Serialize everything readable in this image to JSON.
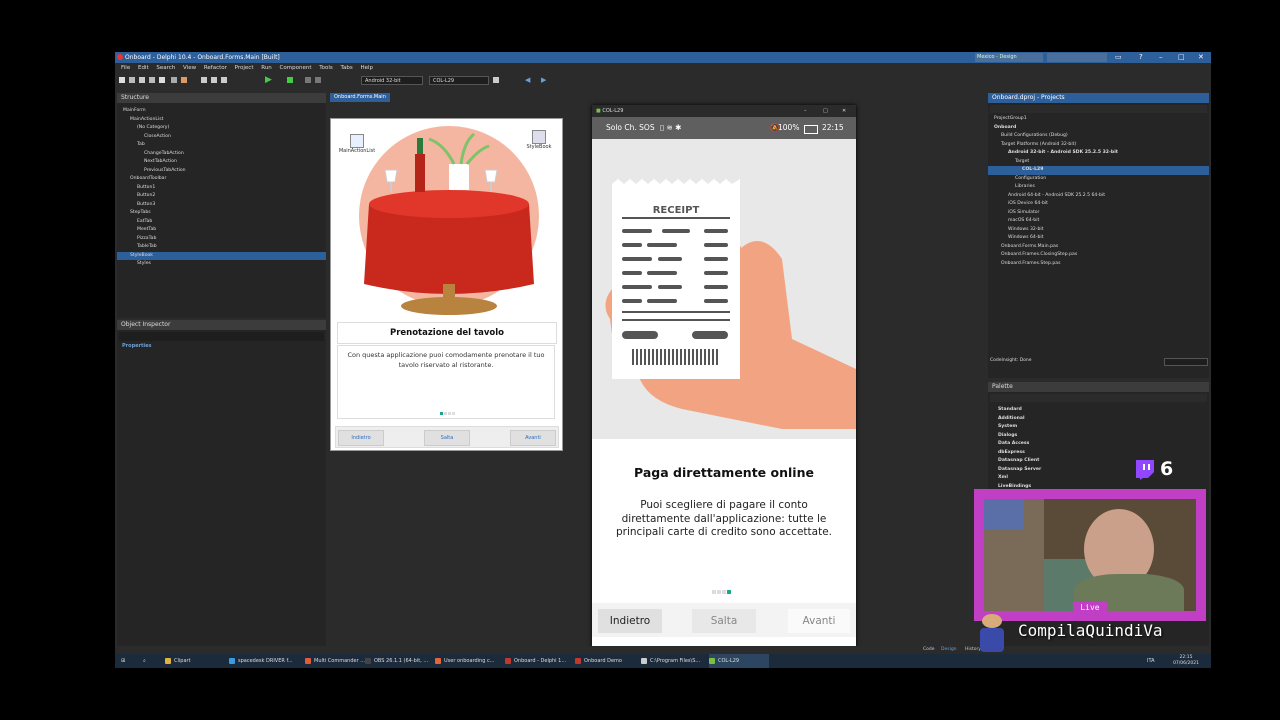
{
  "window": {
    "title": "Onboard - Delphi 10.4 - Onboard.Forms.Main [Built]",
    "search_placeholder": "Mexico - Design"
  },
  "menu": [
    "File",
    "Edit",
    "Search",
    "View",
    "Refactor",
    "Project",
    "Run",
    "Component",
    "Tools",
    "Tabs",
    "Help"
  ],
  "toolbar": {
    "platform": "Android 32-bit",
    "device": "COL-L29"
  },
  "structure": {
    "title": "Structure",
    "items": [
      {
        "label": "MainForm",
        "depth": 0
      },
      {
        "label": "MainActionList",
        "depth": 1
      },
      {
        "label": "(No Category)",
        "depth": 2
      },
      {
        "label": "CloseAction",
        "depth": 3
      },
      {
        "label": "Tab",
        "depth": 2
      },
      {
        "label": "ChangeTabAction",
        "depth": 3
      },
      {
        "label": "NextTabAction",
        "depth": 3
      },
      {
        "label": "PreviousTabAction",
        "depth": 3
      },
      {
        "label": "OnboardToolbar",
        "depth": 1
      },
      {
        "label": "Button1",
        "depth": 2
      },
      {
        "label": "Button2",
        "depth": 2
      },
      {
        "label": "Button3",
        "depth": 2
      },
      {
        "label": "StepTabs",
        "depth": 1
      },
      {
        "label": "EatTab",
        "depth": 2
      },
      {
        "label": "MeetTab",
        "depth": 2
      },
      {
        "label": "PizzaTab",
        "depth": 2
      },
      {
        "label": "TableTab",
        "depth": 2
      },
      {
        "label": "StyleBook",
        "depth": 1,
        "selected": true
      },
      {
        "label": "Styles",
        "depth": 2
      }
    ]
  },
  "object_inspector": {
    "title": "Object Inspector",
    "tab": "Properties"
  },
  "editor_tab": "Onboard.Forms.Main",
  "form": {
    "comp1": "MainActionList",
    "comp2": "StyleBook",
    "title": "Prenotazione del tavolo",
    "text": "Con questa applicazione puoi comodamente prenotare il tuo tavolo riservato al ristorante.",
    "btn_back": "Indietro",
    "btn_skip": "Salta",
    "btn_next": "Avanti"
  },
  "device_window": {
    "title": "COL-L29"
  },
  "phone": {
    "status_left": "Solo Ch. SOS",
    "status_right": "100%",
    "time": "22:15",
    "receipt": "RECEIPT",
    "title": "Paga direttamente online",
    "text": "Puoi scegliere di pagare il conto direttamente dall'applicazione: tutte le principali carte di credito sono accettate.",
    "btn_back": "Indietro",
    "btn_skip": "Salta",
    "btn_next": "Avanti",
    "page_index": 3,
    "page_count": 4
  },
  "projects": {
    "title": "Onboard.dproj - Projects",
    "items": [
      {
        "label": "ProjectGroup1",
        "depth": 0
      },
      {
        "label": "Onboard",
        "depth": 0,
        "bold": true
      },
      {
        "label": "Build Configurations (Debug)",
        "depth": 1
      },
      {
        "label": "Target Platforms (Android 32-bit)",
        "depth": 1
      },
      {
        "label": "Android 32-bit - Android SDK 25.2.5 32-bit",
        "depth": 2,
        "bold": true
      },
      {
        "label": "Target",
        "depth": 3
      },
      {
        "label": "COL-L29",
        "depth": 4,
        "selected": true,
        "bold": true
      },
      {
        "label": "Configuration",
        "depth": 3
      },
      {
        "label": "Libraries",
        "depth": 3
      },
      {
        "label": "Android 64-bit - Android SDK 25.2.5 64-bit",
        "depth": 2
      },
      {
        "label": "iOS Device 64-bit",
        "depth": 2
      },
      {
        "label": "iOS Simulator",
        "depth": 2
      },
      {
        "label": "macOS 64-bit",
        "depth": 2
      },
      {
        "label": "Windows 32-bit",
        "depth": 2
      },
      {
        "label": "Windows 64-bit",
        "depth": 2
      },
      {
        "label": "Onboard.Forms.Main.pas",
        "depth": 1
      },
      {
        "label": "Onboard.Frames.ClosingStep.pas",
        "depth": 1
      },
      {
        "label": "Onboard.Frames.Step.pas",
        "depth": 1
      }
    ],
    "codeinsight": "CodeInsight: Done"
  },
  "palette": {
    "title": "Palette",
    "items": [
      "Standard",
      "Additional",
      "System",
      "Dialogs",
      "Data Access",
      "dbExpress",
      "Datasnap Client",
      "Datasnap Server",
      "Xml",
      "LiveBindings"
    ]
  },
  "statusbar": {
    "code": "Code",
    "design": "Design",
    "history": "History"
  },
  "taskbar": {
    "items": [
      {
        "label": "Clipart",
        "color": "#e2b33a"
      },
      {
        "label": "spacedesk DRIVER f...",
        "color": "#3a9ae2"
      },
      {
        "label": "Multi Commander ...",
        "color": "#e25c3a"
      },
      {
        "label": "OBS 26.1.1 (64-bit, ...",
        "color": "#444444"
      },
      {
        "label": "User onboarding c...",
        "color": "#e2653a"
      },
      {
        "label": "Onboard - Delphi 1...",
        "color": "#c0392b"
      },
      {
        "label": "Onboard Demo",
        "color": "#c0392b"
      },
      {
        "label": "C:\\Program Files\\S...",
        "color": "#cccccc"
      },
      {
        "label": "COL-L29",
        "color": "#7ac143",
        "active": true
      }
    ],
    "tray_lang": "ITA",
    "time": "22:15",
    "date": "07/06/2021"
  },
  "stream": {
    "live": "Live",
    "channel": "CompilaQuindiVa",
    "viewers": "6"
  }
}
